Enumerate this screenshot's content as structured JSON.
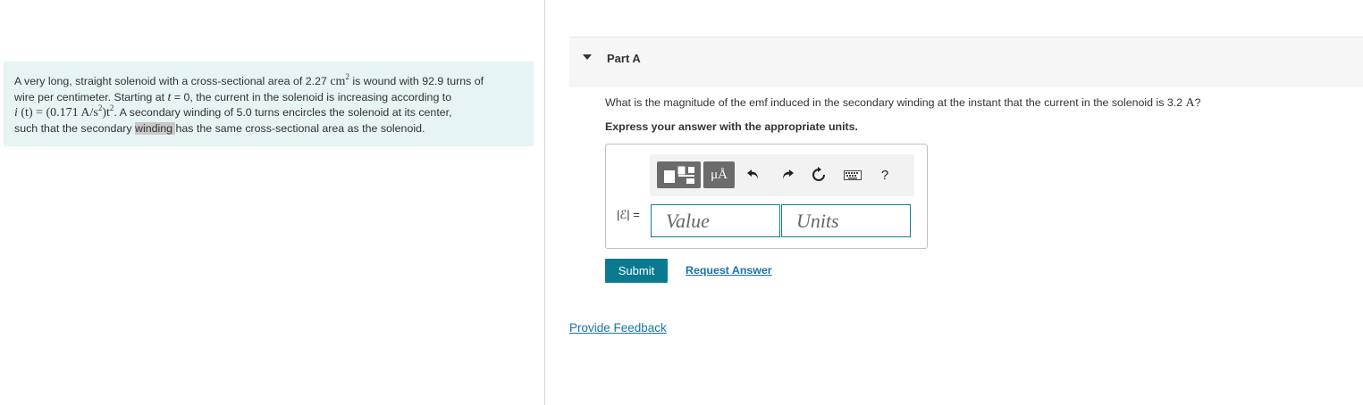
{
  "problem": {
    "text_1": "A very long, straight solenoid with a cross-sectional area of 2.27 ",
    "area_unit": "cm",
    "area_exp": "2",
    "text_2": " is wound with 92.9 turns of",
    "line2_1": "wire per centimeter. Starting at ",
    "t_var": "t",
    "line2_2": " = 0, the current in the solenoid is increasing according to",
    "eq_i": "i",
    "eq_mid": " (t) = (0.171 A/s",
    "eq_exp1": "2",
    "eq_end": ")t",
    "eq_exp2": "2",
    "line3_rest": ". A secondary winding of 5.0 turns encircles the solenoid at its center,",
    "line4_1": "such that the secondary ",
    "line4_hl": "winding ",
    "line4_2": "has the same cross-sectional area as the solenoid."
  },
  "part": {
    "label": "Part A"
  },
  "question": {
    "text": "What is the magnitude of the emf induced in the secondary winding at the instant that the current in the solenoid is 3.2 ",
    "unit": "A",
    "tail": "?"
  },
  "instruction": "Express your answer with the appropriate units.",
  "toolbar": {
    "units_label": "μÅ",
    "help_label": "?",
    "icons": [
      "templates-icon",
      "units-icon",
      "undo-icon",
      "redo-icon",
      "reset-icon",
      "keyboard-icon",
      "help-icon"
    ]
  },
  "answer": {
    "symbol": "|ℰ| =",
    "value_placeholder": "Value",
    "units_placeholder": "Units"
  },
  "buttons": {
    "submit": "Submit",
    "request_answer": "Request Answer"
  },
  "feedback_link": "Provide Feedback",
  "colors": {
    "accent": "#0a7a91",
    "link": "#1a73a8",
    "problem_bg": "#e6f4f4"
  }
}
